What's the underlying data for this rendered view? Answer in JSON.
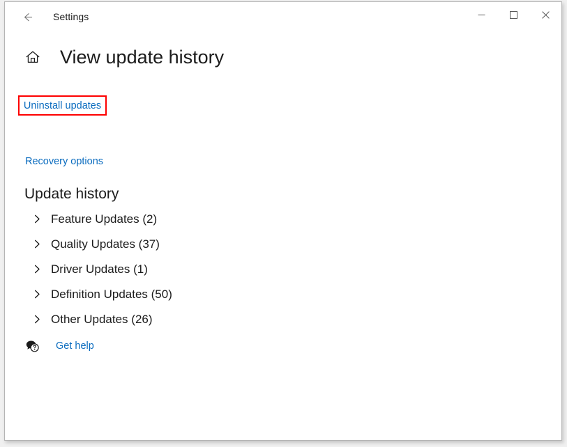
{
  "window": {
    "title": "Settings",
    "back_icon": "back-arrow-icon",
    "minimize_label": "─",
    "maximize_label": "□",
    "close_label": "✕"
  },
  "page": {
    "home_icon": "home-icon",
    "title": "View update history"
  },
  "links": {
    "uninstall_updates": "Uninstall updates",
    "recovery_options": "Recovery options"
  },
  "highlight": {
    "color": "#fe0000",
    "target": "Uninstall updates"
  },
  "section": {
    "heading": "Update history",
    "categories": [
      {
        "label": "Feature Updates (2)",
        "name": "feature-updates",
        "count": 2
      },
      {
        "label": "Quality Updates (37)",
        "name": "quality-updates",
        "count": 37
      },
      {
        "label": "Driver Updates (1)",
        "name": "driver-updates",
        "count": 1
      },
      {
        "label": "Definition Updates (50)",
        "name": "definition-updates",
        "count": 50
      },
      {
        "label": "Other Updates (26)",
        "name": "other-updates",
        "count": 26
      }
    ]
  },
  "help": {
    "icon": "chat-question-icon",
    "label": "Get help"
  },
  "colors": {
    "link": "#0b6cbf",
    "text": "#1b1b1b",
    "background": "#ffffff",
    "highlight": "#fe0000"
  }
}
